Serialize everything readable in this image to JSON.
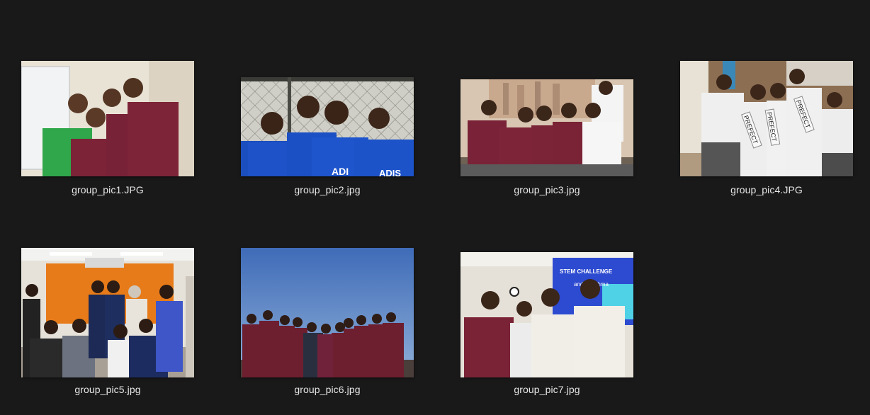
{
  "files": [
    {
      "name": "group_pic1.JPG"
    },
    {
      "name": "group_pic2.jpg"
    },
    {
      "name": "group_pic3.jpg"
    },
    {
      "name": "group_pic4.JPG"
    },
    {
      "name": "group_pic5.jpg"
    },
    {
      "name": "group_pic6.jpg"
    },
    {
      "name": "group_pic7.jpg"
    }
  ],
  "thumbnail_text": {
    "pic2_shirt_1": "ADI",
    "pic2_shirt_2": "ADIS",
    "pic4_sash_1": "PREFECT",
    "pic4_sash_2": "PREFECT",
    "pic4_sash_3": "PREFECT",
    "pic7_screen_line_1": "STEM CHALLENGE",
    "pic7_screen_line_2": "and Marshma"
  },
  "colors": {
    "background": "#191919",
    "label_text": "#e6e6e6"
  }
}
